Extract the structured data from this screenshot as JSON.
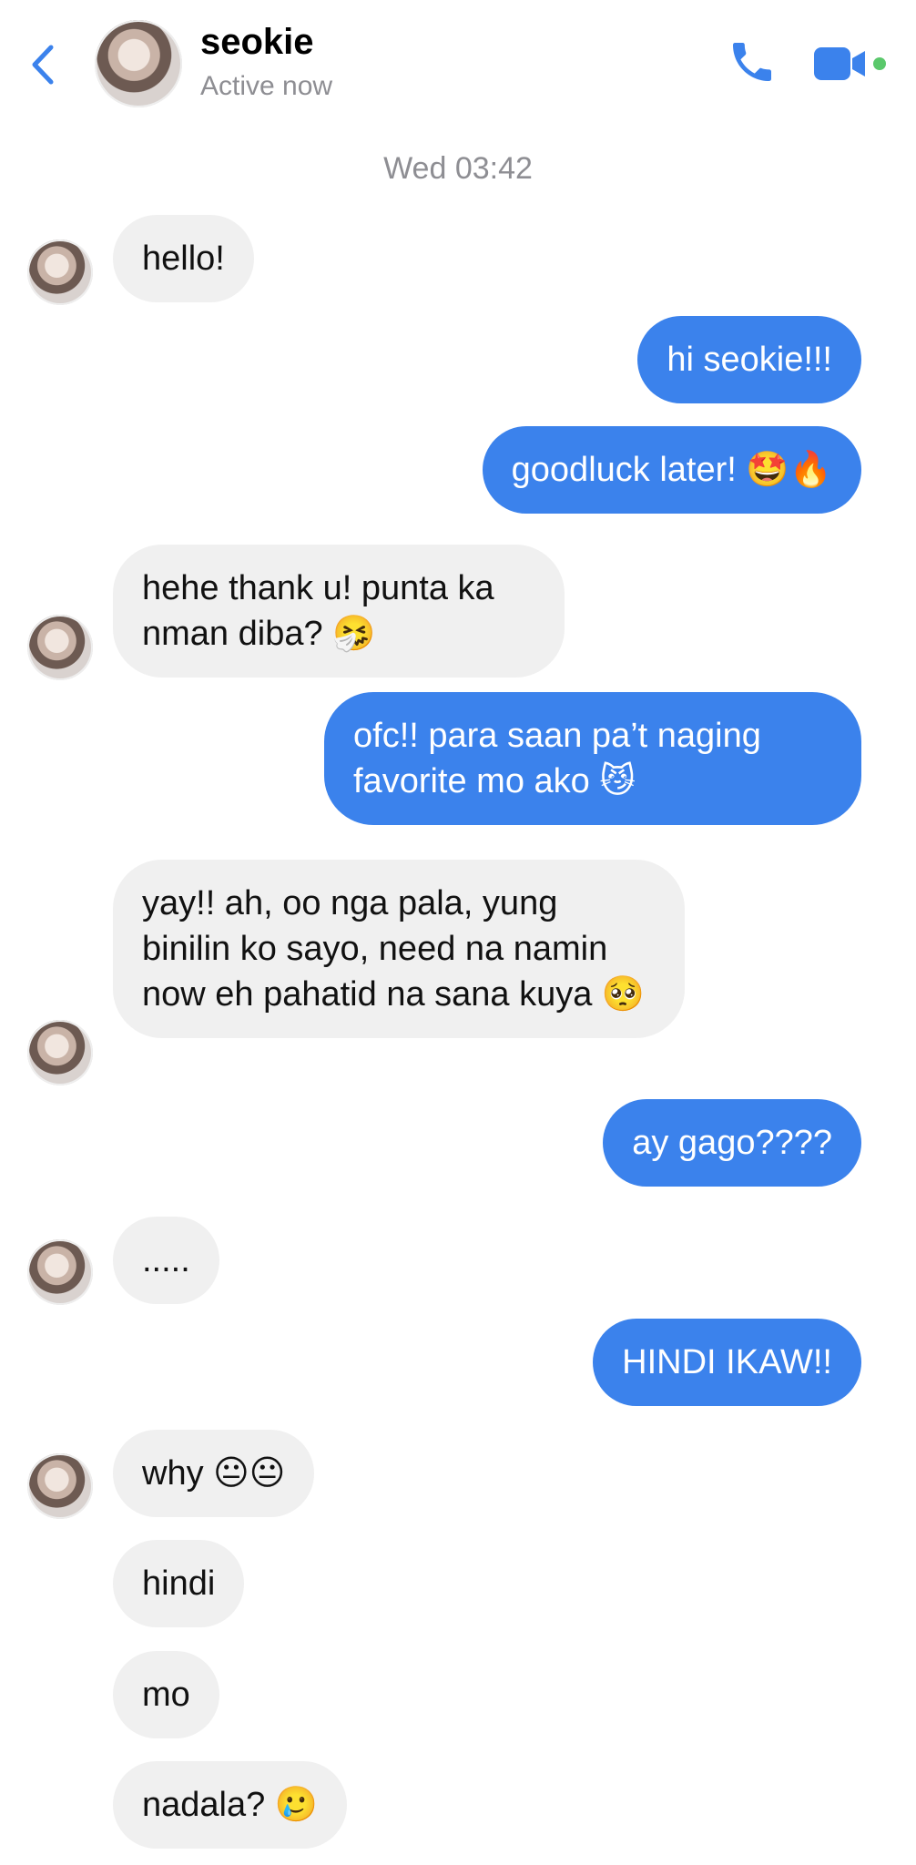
{
  "header": {
    "contact_name": "seokie",
    "status": "Active now",
    "accent_color": "#3b82ec",
    "online_dot_color": "#5ac86b",
    "icons": [
      "chevron-left-icon",
      "phone-icon",
      "video-camera-icon"
    ]
  },
  "timestamp": "Wed 03:42",
  "messages": [
    {
      "from": "them",
      "text": "hello!"
    },
    {
      "from": "me",
      "text": "hi seokie!!!"
    },
    {
      "from": "me",
      "text": "goodluck later! 🤩🔥"
    },
    {
      "from": "them",
      "text": "hehe thank u! punta ka nman diba? 🤧"
    },
    {
      "from": "me",
      "text": "ofc!! para saan pa’t naging favorite mo ako 😼"
    },
    {
      "from": "them",
      "text": "yay!! ah, oo nga pala, yung binilin ko sayo, need na namin now eh pahatid na sana kuya 🥺"
    },
    {
      "from": "me",
      "text": "ay gago????"
    },
    {
      "from": "them",
      "text": "....."
    },
    {
      "from": "me",
      "text": "HINDI IKAW!!"
    },
    {
      "from": "them",
      "text": "why 😐😐"
    },
    {
      "from": "them",
      "text": "hindi"
    },
    {
      "from": "them",
      "text": "mo"
    },
    {
      "from": "them",
      "text": "nadala? 🥲"
    }
  ]
}
